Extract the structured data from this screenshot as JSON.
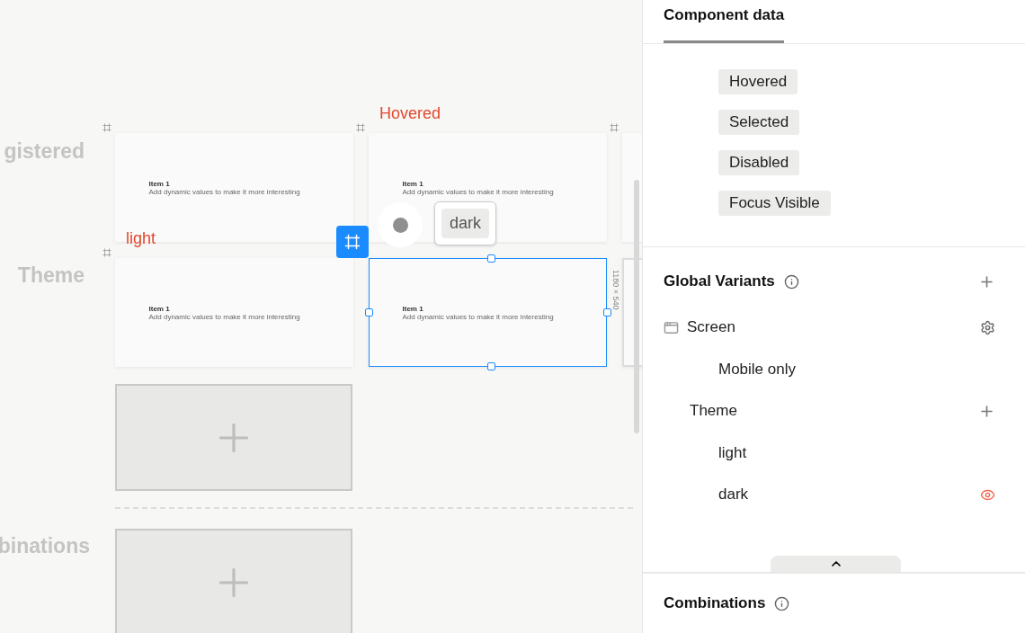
{
  "canvas": {
    "row_labels": [
      "gistered",
      "Theme",
      "binations"
    ],
    "variant_labels": [
      "Hovered",
      "light"
    ],
    "frames": [
      {
        "item_title": "Item 1",
        "item_text": "Add dynamic values to make it more interesting",
        "selected": false
      },
      {
        "item_title": "Item 1",
        "item_text": "Add dynamic values to make it more interesting",
        "selected": false
      },
      {
        "item_title": "Item 1",
        "item_text": "Add dynamic values to make it more interesting",
        "selected": false
      },
      {
        "item_title": "Item 1",
        "item_text": "Add dynamic values to make it more interesting",
        "selected": true
      }
    ],
    "dimension": "1180 × 540",
    "tooltip": "dark"
  },
  "panel": {
    "tabs": [
      {
        "label": "Component data",
        "selected": true
      }
    ],
    "states": [
      "Hovered",
      "Selected",
      "Disabled",
      "Focus Visible"
    ],
    "global_variants": {
      "title": "Global Variants",
      "groups": [
        {
          "name": "Screen",
          "options": [
            {
              "label": "Mobile only",
              "previewing": false
            }
          ]
        },
        {
          "name": "Theme",
          "options": [
            {
              "label": "light",
              "previewing": false
            },
            {
              "label": "dark",
              "previewing": true
            }
          ]
        }
      ]
    },
    "combinations": {
      "title": "Combinations"
    }
  }
}
